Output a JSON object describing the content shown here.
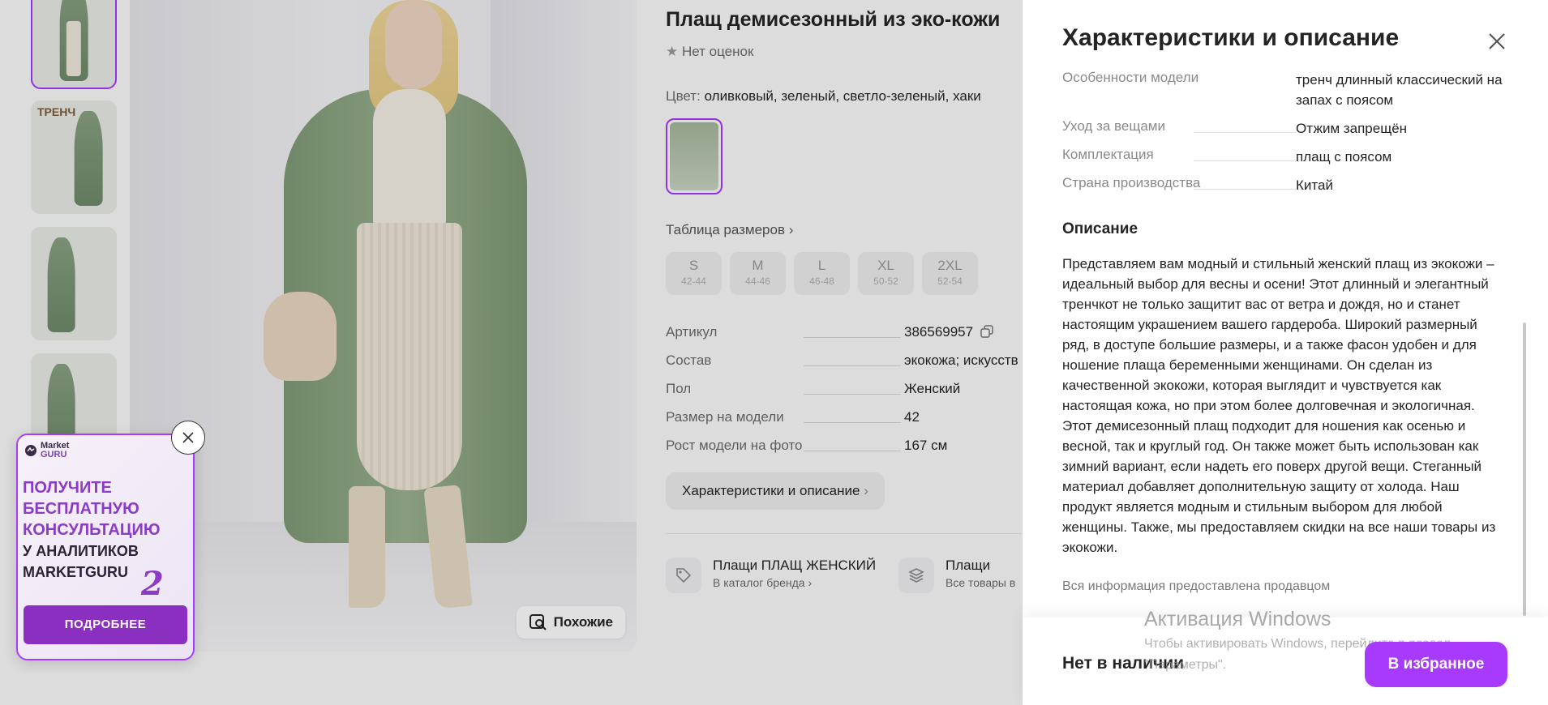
{
  "product": {
    "title": "Плащ демисезонный из эко-кожи",
    "rating_text": "Нет оценок",
    "color_label": "Цвет:",
    "color_value": "оливковый, зеленый, светло-зеленый, хаки",
    "size_table_link": "Таблица размеров",
    "sizes": [
      {
        "size": "S",
        "range": "42-44"
      },
      {
        "size": "M",
        "range": "44-46"
      },
      {
        "size": "L",
        "range": "46-48"
      },
      {
        "size": "XL",
        "range": "50-52"
      },
      {
        "size": "2XL",
        "range": "52-54"
      }
    ],
    "specs": [
      {
        "key": "Артикул",
        "value": "386569957"
      },
      {
        "key": "Состав",
        "value": "экокожа; искусств"
      },
      {
        "key": "Пол",
        "value": "Женский"
      },
      {
        "key": "Размер на модели",
        "value": "42"
      },
      {
        "key": "Рост модели на фото",
        "value": "167 см"
      }
    ],
    "characteristics_button": "Характеристики и описание",
    "brand_links": [
      {
        "title": "Плащи ПЛАЩ ЖЕНСКИЙ",
        "subtitle": "В каталог бренда"
      },
      {
        "title": "Плащи",
        "subtitle": "Все товары в"
      }
    ],
    "similar_button": "Похожие"
  },
  "thumbnails": [
    {
      "label": ""
    },
    {
      "label": "ТРЕНЧ"
    },
    {
      "label": ""
    },
    {
      "label": ""
    }
  ],
  "promo": {
    "logo_top": "Market",
    "logo_bottom": "GURU",
    "lines": [
      "ПОЛУЧИТЕ",
      "БЕСПЛАТНУЮ",
      "КОНСУЛЬТАЦИЮ"
    ],
    "lines_dark": [
      "У АНАЛИТИКОВ",
      "MARKETGURU"
    ],
    "number": "2",
    "button": "ПОДРОБНЕЕ"
  },
  "panel": {
    "title": "Характеристики и описание",
    "specs": [
      {
        "key": "Особенности модели",
        "value": "тренч длинный классический на запах с поясом"
      },
      {
        "key": "Уход за вещами",
        "value": "Отжим запрещён"
      },
      {
        "key": "Комплектация",
        "value": "плащ с поясом"
      },
      {
        "key": "Страна производства",
        "value": "Китай"
      }
    ],
    "description_title": "Описание",
    "description": "Представляем вам модный и стильный женский плащ из экокожи – идеальный выбор для весны и осени! Этот длинный и элегантный тренчкот не только защитит вас от ветра и дождя, но и станет настоящим украшением вашего гардероба. Широкий размерный ряд, в доступе большие размеры, и а также фасон удобен и для ношение плаща беременными женщинами. Он сделан из качественной экокожи, которая выглядит и чувствуется как настоящая кожа, но при этом более долговечная и экологичная. Этот демисезонный плащ подходит для ношения как осенью и весной, так и круглый год. Он также может быть использован как зимний вариант, если надеть его поверх другой вещи. Стеганный материал добавляет дополнительную защиту от холода. Наш продукт является модным и стильным выбором для любой женщины. Также, мы предоставляем скидки на все наши товары из экокожи.",
    "footnote": "Вся информация предоставлена продавцом",
    "stock_status": "Нет в наличии",
    "favorite_button": "В избранное"
  },
  "watermark": {
    "line1": "Активация Windows",
    "line2": "Чтобы активировать Windows, перейдите в раздел \"Параметры\"."
  },
  "colors": {
    "accent": "#a73afd",
    "promo_purple": "#8a2fc0"
  }
}
